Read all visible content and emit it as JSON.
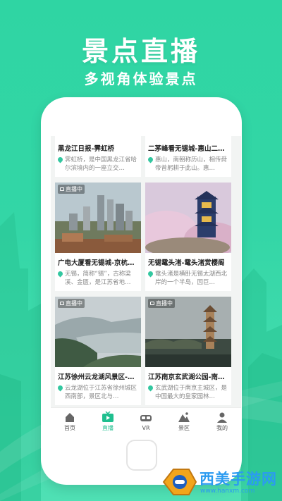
{
  "headline": "景点直播",
  "subline": "多视角体验景点",
  "cards": [
    {
      "title": "黑龙江日报-霁虹桥",
      "desc": "霁虹桥，是中国黑龙江省哈尔滨境内的一座立交…",
      "live": ""
    },
    {
      "title": "二茅峰看无锡城-惠山二…",
      "desc": "惠山，南朝称历山，相传舜帝曾躬耕于此山。惠…",
      "live": ""
    },
    {
      "title": "广电大厦看无锡城-京杭…",
      "desc": "无锡，简称“锡”，古称梁溪、金匮，是江苏省地…",
      "live": "直播中"
    },
    {
      "title": "无锡鼋头渚-鼋头渚赏樱阁",
      "desc": "鼋头渚是横卧无锡太湖西北岸的一个半岛，因巨…",
      "live": ""
    },
    {
      "title": "江苏徐州云龙湖风景区-…",
      "desc": "云龙湖位于江苏省徐州城区西南部，景区北与…",
      "live": "直播中"
    },
    {
      "title": "江苏南京玄武湖公园-南…",
      "desc": "玄武湖位于南京主城区，是中国最大的皇家园林…",
      "live": "直播中"
    }
  ],
  "tabs": [
    {
      "label": "首页",
      "icon": "home-icon"
    },
    {
      "label": "直播",
      "icon": "tv-icon",
      "active": true
    },
    {
      "label": "VR",
      "icon": "vr-icon"
    },
    {
      "label": "景区",
      "icon": "mountain-icon"
    },
    {
      "label": "我的",
      "icon": "user-icon"
    }
  ],
  "watermark": {
    "name": "西美手游网",
    "url": "www.hanxm.com"
  },
  "colors": {
    "accent": "#1fbf8f",
    "background": "#33d6a6"
  }
}
